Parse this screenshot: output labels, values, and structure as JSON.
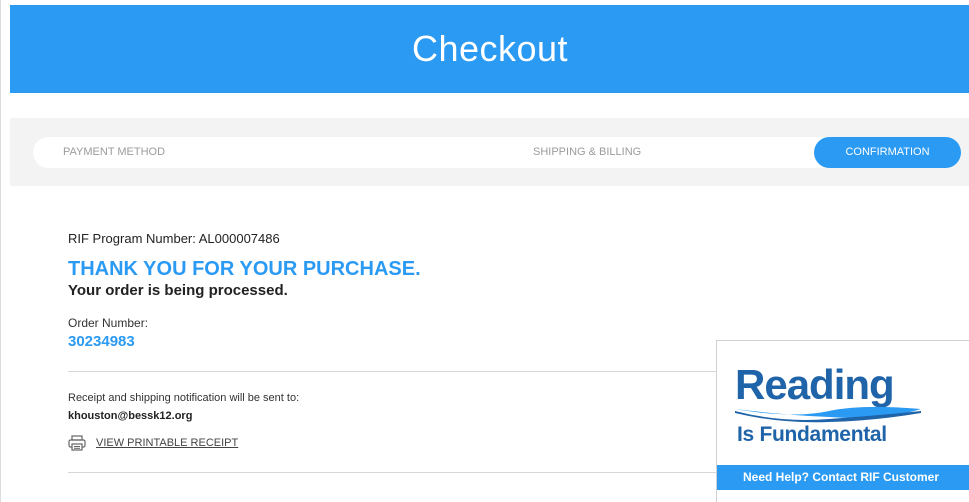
{
  "header": {
    "title": "Checkout"
  },
  "steps": [
    {
      "label": "PAYMENT METHOD"
    },
    {
      "label": "SHIPPING & BILLING"
    },
    {
      "label": "CONFIRMATION"
    }
  ],
  "confirmation": {
    "program_number": "RIF Program Number: AL000007486",
    "thanks": "THANK YOU FOR YOUR PURCHASE.",
    "status": "Your order is being processed.",
    "order_label": "Order Number:",
    "order_number": "30234983",
    "receipt_note": "Receipt and shipping notification will be sent to:",
    "email": "khouston@bessk12.org",
    "print_link": "VIEW PRINTABLE RECEIPT"
  },
  "rif": {
    "logo_line1": "Reading",
    "logo_line2": "Is Fundamental",
    "help_text": "Need Help? Contact RIF Customer"
  },
  "colors": {
    "accent": "#2b9af3",
    "logo": "#1f63a8"
  }
}
